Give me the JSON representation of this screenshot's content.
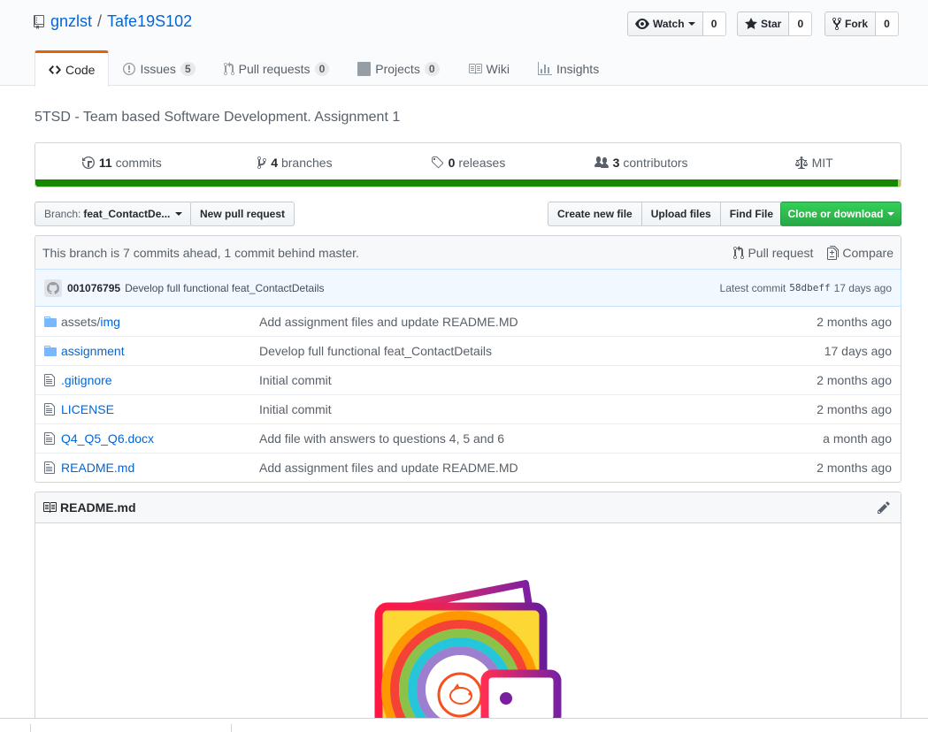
{
  "repo": {
    "owner": "gnzlst",
    "separator": "/",
    "name": "Tafe19S102",
    "description": "5TSD - Team based Software Development. Assignment 1"
  },
  "actions": {
    "watch_label": "Watch",
    "watch_count": "0",
    "star_label": "Star",
    "star_count": "0",
    "fork_label": "Fork",
    "fork_count": "0"
  },
  "nav": {
    "code": "Code",
    "issues": "Issues",
    "issues_count": "5",
    "pulls": "Pull requests",
    "pulls_count": "0",
    "projects": "Projects",
    "projects_count": "0",
    "wiki": "Wiki",
    "insights": "Insights"
  },
  "summary": {
    "commits_count": "11",
    "commits_label": "commits",
    "branches_count": "4",
    "branches_label": "branches",
    "releases_count": "0",
    "releases_label": "releases",
    "contributors_count": "3",
    "contributors_label": "contributors",
    "license": "MIT"
  },
  "filenav": {
    "branch_prefix": "Branch:",
    "branch_name": "feat_ContactDe...",
    "new_pr": "New pull request",
    "create_file": "Create new file",
    "upload_files": "Upload files",
    "find_file": "Find File",
    "clone": "Clone or download"
  },
  "branch_info": {
    "message": "This branch is 7 commits ahead, 1 commit behind master.",
    "pull_request": "Pull request",
    "compare": "Compare"
  },
  "latest_commit": {
    "author": "001076795",
    "message": "Develop full functional feat_ContactDetails",
    "prefix": "Latest commit",
    "sha": "58dbeff",
    "age": "17 days ago"
  },
  "files": [
    {
      "type": "dir",
      "dir_prefix": "assets/",
      "name": "img",
      "message": "Add assignment files and update README.MD",
      "age": "2 months ago"
    },
    {
      "type": "dir",
      "dir_prefix": "",
      "name": "assignment",
      "message": "Develop full functional feat_ContactDetails",
      "age": "17 days ago"
    },
    {
      "type": "file",
      "dir_prefix": "",
      "name": ".gitignore",
      "message": "Initial commit",
      "age": "2 months ago"
    },
    {
      "type": "file",
      "dir_prefix": "",
      "name": "LICENSE",
      "message": "Initial commit",
      "age": "2 months ago"
    },
    {
      "type": "file",
      "dir_prefix": "",
      "name": "Q4_Q5_Q6.docx",
      "message": "Add file with answers to questions 4, 5 and 6",
      "age": "a month ago"
    },
    {
      "type": "file",
      "dir_prefix": "",
      "name": "README.md",
      "message": "Add assignment files and update README.MD",
      "age": "2 months ago"
    }
  ],
  "readme": {
    "title": "README.md"
  },
  "colors": {
    "link": "#0366d6",
    "selected_tab": "#e36209",
    "language_bar": "#178600",
    "clone_button": "#28a745"
  }
}
